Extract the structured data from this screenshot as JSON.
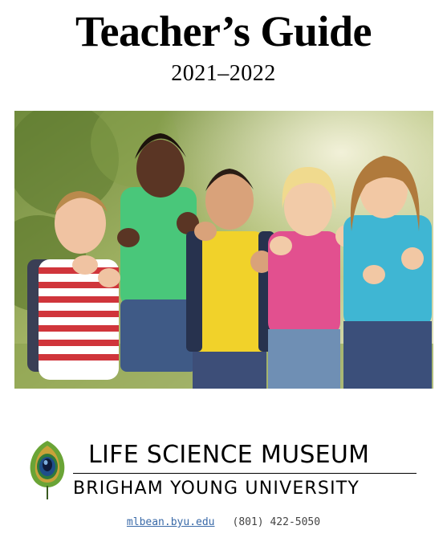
{
  "title": "Teacher’s Guide",
  "years": "2021–2022",
  "photo": {
    "icon": "children-thumbs-up-photo"
  },
  "logo": {
    "icon": "peacock-feather-logo",
    "primary_text": "LIFE SCIENCE MUSEUM",
    "secondary_text": "BRIGHAM YOUNG UNIVERSITY"
  },
  "contact": {
    "website": "mlbean.byu.edu",
    "phone": "(801) 422-5050"
  },
  "colors": {
    "link": "#3a6aa8",
    "feather_green": "#5a9a2a",
    "feather_blue": "#1f4e8a"
  }
}
